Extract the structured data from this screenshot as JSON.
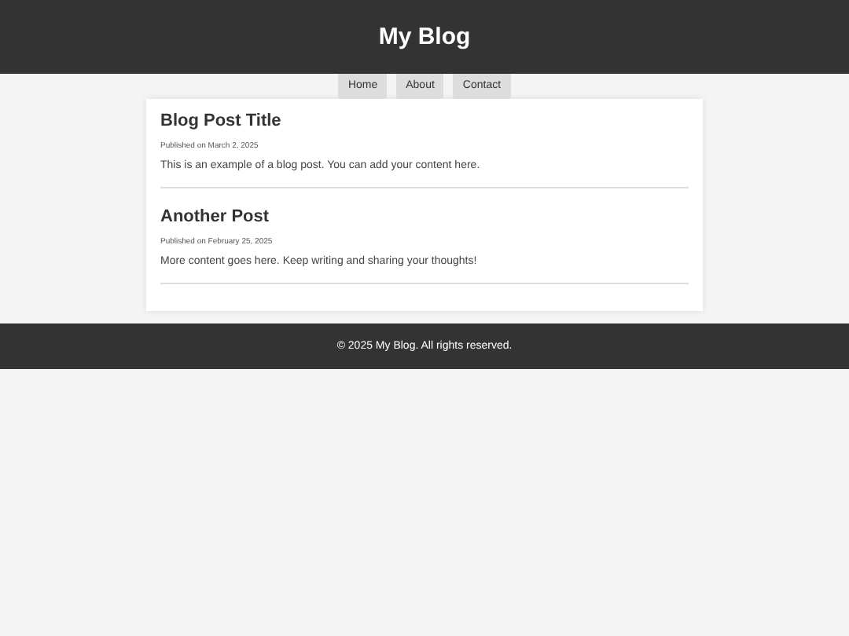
{
  "header": {
    "title": "My Blog"
  },
  "nav": [
    {
      "label": "Home"
    },
    {
      "label": "About"
    },
    {
      "label": "Contact"
    }
  ],
  "posts": [
    {
      "title": "Blog Post Title",
      "date": "Published on March 2, 2025",
      "body": "This is an example of a blog post. You can add your content here."
    },
    {
      "title": "Another Post",
      "date": "Published on February 25, 2025",
      "body": "More content goes here. Keep writing and sharing your thoughts!"
    }
  ],
  "footer": {
    "text": "© 2025 My Blog. All rights reserved."
  }
}
